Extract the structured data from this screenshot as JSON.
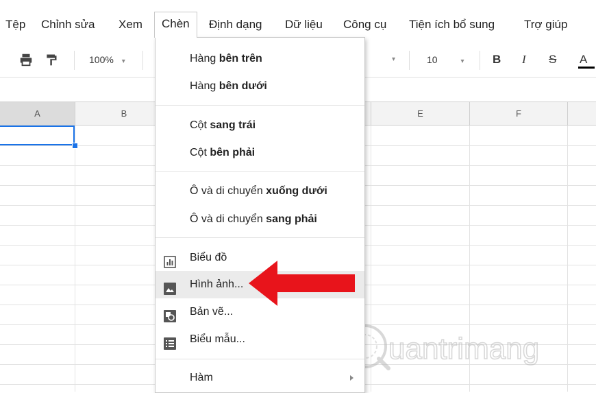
{
  "menubar": {
    "items": [
      "Tệp",
      "Chỉnh sửa",
      "Xem",
      "Chèn",
      "Định dạng",
      "Dữ liệu",
      "Công cụ",
      "Tiện ích bổ sung",
      "Trợ giúp"
    ]
  },
  "toolbar": {
    "zoom": "100%",
    "font_size": "10",
    "bold": "B",
    "italic": "I",
    "strike": "S",
    "text_color": "A"
  },
  "columns": [
    "A",
    "B",
    "E",
    "F"
  ],
  "insert_menu": {
    "row_above_prefix": "Hàng ",
    "row_above_bold": "bên trên",
    "row_below_prefix": "Hàng ",
    "row_below_bold": "bên dưới",
    "col_left_prefix": "Cột ",
    "col_left_bold": "sang trái",
    "col_right_prefix": "Cột ",
    "col_right_bold": "bên phải",
    "cell_down_prefix": "Ô và di chuyển ",
    "cell_down_bold": "xuống dưới",
    "cell_right_prefix": "Ô và di chuyển ",
    "cell_right_bold": "sang phải",
    "chart": "Biểu đồ",
    "image": "Hình ảnh...",
    "drawing": "Bản vẽ...",
    "form": "Biểu mẫu...",
    "function": "Hàm"
  },
  "watermark": {
    "text": "uantrimang"
  },
  "colors": {
    "accent": "#1a73e8",
    "arrow": "#e8141b"
  }
}
